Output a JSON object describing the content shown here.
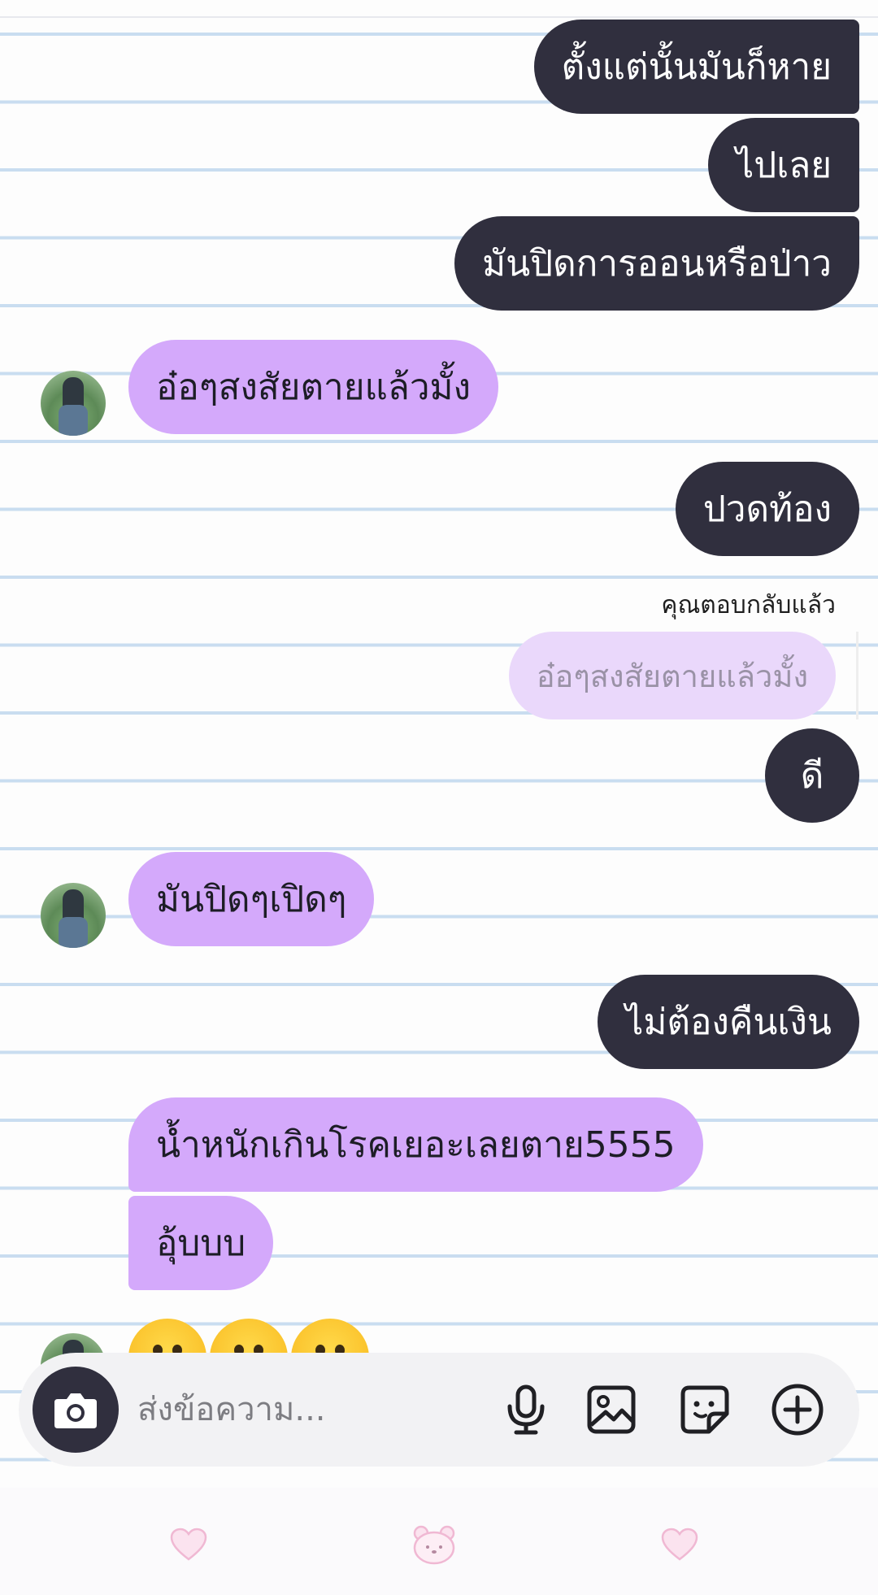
{
  "messages": [
    {
      "side": "out",
      "text": "ตั้งแต่นั้นมันก็หาย"
    },
    {
      "side": "out",
      "text": "ไปเลย"
    },
    {
      "side": "out",
      "text": "มันปิดการออนหรือป่าว"
    },
    {
      "side": "in",
      "text": "อ๋อๆสงสัยตายแล้วมั้ง"
    },
    {
      "side": "out",
      "text": "ปวดท้อง"
    },
    {
      "side": "out",
      "text": "ดี"
    },
    {
      "side": "in",
      "text": "มันปิดๆเปิดๆ"
    },
    {
      "side": "out",
      "text": "ไม่ต้องคืนเงิน"
    },
    {
      "side": "in",
      "text": "น้ำหนักเกินโรคเยอะเลยตาย5555"
    },
    {
      "side": "in",
      "text": "อุ้บบบ"
    }
  ],
  "reply": {
    "label": "คุณตอบกลับแล้ว",
    "quoted_text": "อ๋อๆสงสัยตายแล้วมั้ง"
  },
  "emoji_message": [
    "grimacing-face",
    "grimacing-face",
    "grimacing-face"
  ],
  "composer": {
    "placeholder": "ส่งข้อความ...",
    "icons": [
      "camera-icon",
      "microphone-icon",
      "gallery-icon",
      "sticker-icon",
      "plus-icon"
    ]
  },
  "bottom_nav": {
    "icons": [
      "heart-icon",
      "bear-icon",
      "heart-icon"
    ]
  },
  "colors": {
    "outgoing_bubble": "#302f3e",
    "incoming_bubble": "#d4a9fb",
    "reply_quote": "#ead8fb",
    "ruled_line": "#c9ddf0",
    "nav_icon": "#f6cde3"
  }
}
